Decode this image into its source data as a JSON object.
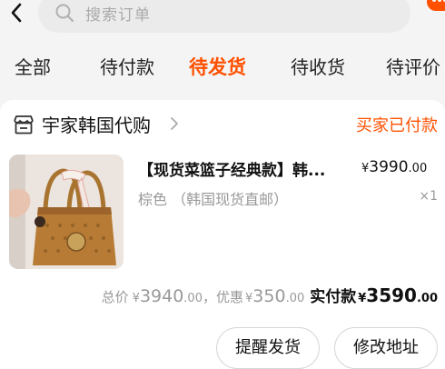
{
  "search": {
    "placeholder": "搜索订单"
  },
  "tabs": [
    {
      "label": "全部"
    },
    {
      "label": "待付款"
    },
    {
      "label": "待发货",
      "active": true
    },
    {
      "label": "待收货"
    },
    {
      "label": "待评价"
    }
  ],
  "order": {
    "store_name": "宇家韩国代购",
    "status": "买家已付款",
    "product": {
      "title": "【现货菜篮子经典款】韩...",
      "price_currency": "¥",
      "price_int": "3990",
      "price_dec": ".00",
      "sku": "棕色 （韩国现货直邮）",
      "qty": "×1"
    },
    "summary": {
      "total_label": "总价",
      "currency": "¥",
      "total_int": "3940",
      "total_dec": ".00",
      "sep": "，",
      "discount_label": "优惠",
      "discount_int": "350",
      "discount_dec": ".00",
      "paid_label": "实付款",
      "paid_int": "3590",
      "paid_dec": ".00"
    },
    "buttons": {
      "remind": "提醒发货",
      "modify": "修改地址"
    }
  },
  "colors": {
    "accent": "#ff5000",
    "background": "#f4f4f4",
    "card": "#ffffff",
    "muted": "#999999"
  },
  "icons": [
    "back-arrow-icon",
    "search-icon",
    "store-icon",
    "chevron-right-icon"
  ]
}
